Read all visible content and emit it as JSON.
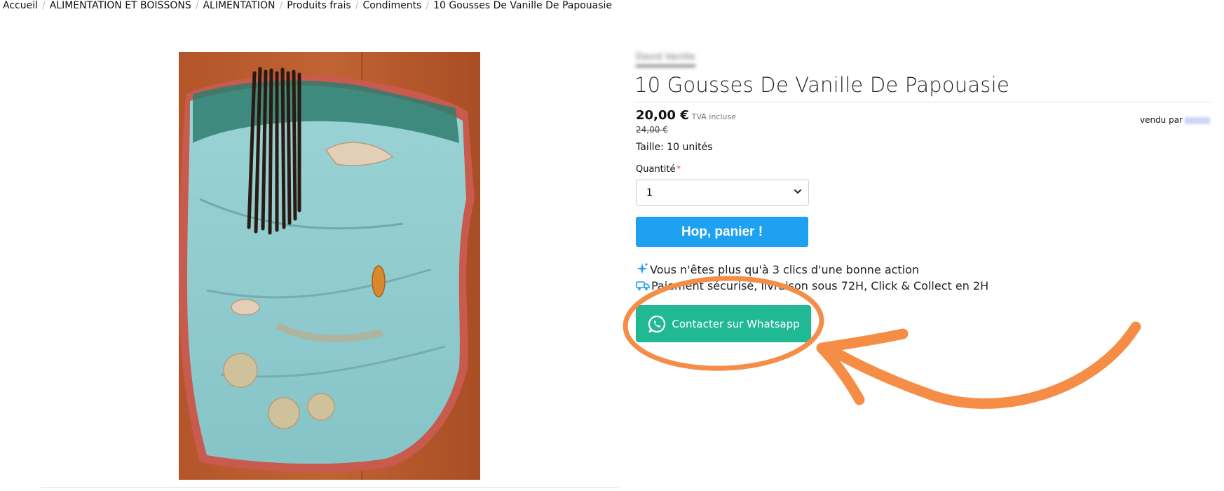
{
  "breadcrumb": [
    "Accueil",
    "ALIMENTATION ET BOISSONS",
    "ALIMENTATION",
    "Produits frais",
    "Condiments",
    "10 Gousses De Vanille De Papouasie"
  ],
  "product": {
    "brand": "David Vanille",
    "title": "10 Gousses De Vanille De Papouasie",
    "price": "20,00 €",
    "tva": "TVA incluse",
    "old_price": "24,00 €",
    "seller_label": "vendu par",
    "size": "Taille: 10 unités"
  },
  "quantity": {
    "label": "Quantité",
    "required_mark": "*",
    "value": "1"
  },
  "cart_button": "Hop, panier !",
  "info": {
    "line1": "Vous n'êtes plus qu'à 3 clics d'une bonne action",
    "line2": "Paiement sécurisé, livraison sous 72H, Click & Collect en 2H"
  },
  "whatsapp_button": "Contacter sur Whatsapp",
  "colors": {
    "cart_button": "#1ea1f1",
    "whatsapp_button": "#21b894",
    "annotation": "#f58d47"
  },
  "icons": [
    "sparkle-icon",
    "delivery-truck-icon",
    "whatsapp-icon",
    "chevron-down-icon"
  ]
}
